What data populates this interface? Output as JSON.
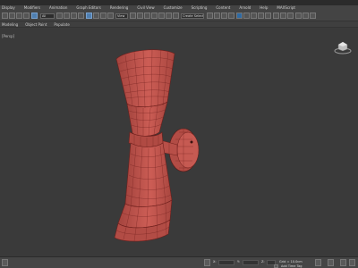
{
  "menu": {
    "items": [
      "Display",
      "Modifiers",
      "Animation",
      "Graph Editors",
      "Rendering",
      "Civil View",
      "Customize",
      "Scripting",
      "Content",
      "Arnold",
      "Help",
      "MAXScript"
    ]
  },
  "toolbar": {
    "filter_dropdown": "All",
    "view_dropdown": "View",
    "selection_set": "Create Selection Se"
  },
  "ribbon": {
    "tabs": [
      "Modeling",
      "Object Paint",
      "Populate"
    ]
  },
  "viewport": {
    "label": "[Persp]"
  },
  "status": {
    "grid_text": "Grid = 10.0cm",
    "add_time_tag": "Add Time Tag",
    "x_field": "",
    "y_field": "",
    "z_field": ""
  },
  "colors": {
    "mesh_fill": "#c95a52",
    "mesh_wire": "#6e1f1c",
    "viewport_bg": "#3a3a3a"
  }
}
